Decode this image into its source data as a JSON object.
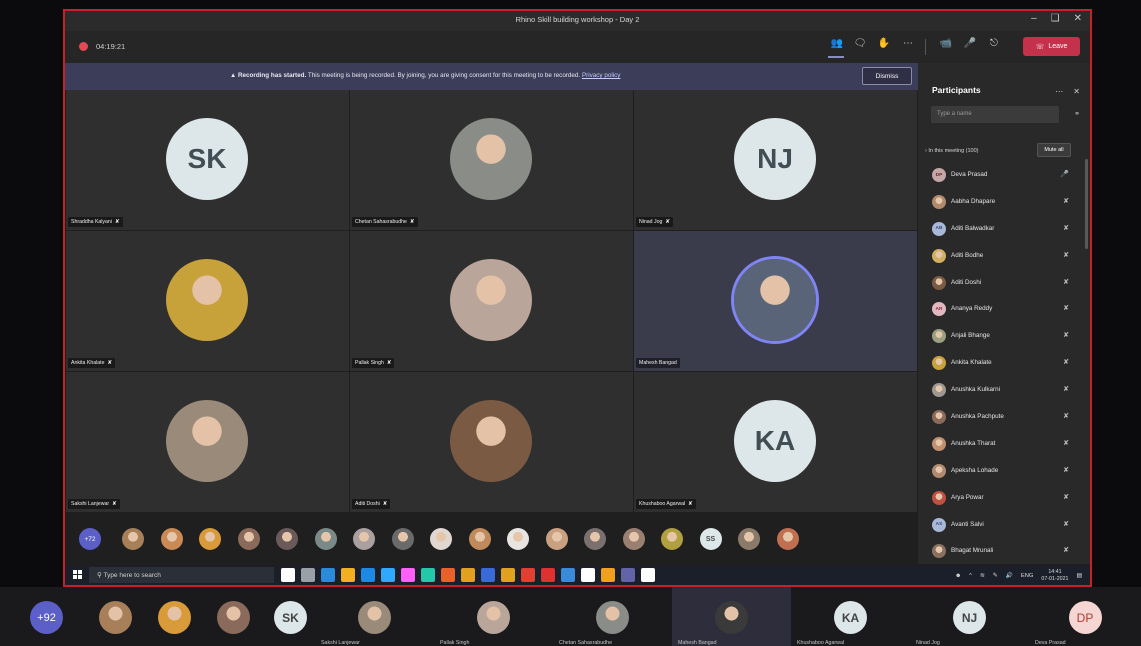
{
  "window": {
    "title": "Rhino Skill building workshop - Day 2"
  },
  "controls": {
    "timer": "04:19:21",
    "leave_label": "Leave"
  },
  "banner": {
    "bold": "Recording has started.",
    "text": "This meeting is being recorded. By joining, you are giving consent for this meeting to be recorded.",
    "link": "Privacy policy",
    "dismiss": "Dismiss"
  },
  "tiles": [
    {
      "name": "Shraddha Kalyani",
      "initials": "SK",
      "kind": "initials"
    },
    {
      "name": "Chetan Sahasrabudhe",
      "kind": "photo",
      "color": "#8a8c88"
    },
    {
      "name": "Ninad Jog",
      "initials": "NJ",
      "kind": "initials"
    },
    {
      "name": "Ankita Khalate",
      "kind": "photo",
      "color": "#c7a13a"
    },
    {
      "name": "Pallak Singh",
      "kind": "photo",
      "color": "#b9a59a"
    },
    {
      "name": "Mahesh Bangad",
      "kind": "photo",
      "color": "#5a6478",
      "speaking": true
    },
    {
      "name": "Sakshi Lanjewar",
      "kind": "photo",
      "color": "#9a8a7a"
    },
    {
      "name": "Aditi Doshi",
      "kind": "photo",
      "color": "#7a5a42"
    },
    {
      "name": "Khushaboo Agarwal",
      "initials": "KA",
      "kind": "initials"
    }
  ],
  "tray": {
    "count": "+72",
    "initials": "SS",
    "colors": [
      "#a7805a",
      "#c98a55",
      "#d99a3a",
      "#8a6a5a",
      "#6a5a5a",
      "#7a8a8a",
      "#aaa0a0",
      "#6a6a6a",
      "#e0d8d0",
      "#c08a5a",
      "#e8e4e0",
      "#c9a080",
      "#7a7070",
      "#9a8070",
      "#b0a040",
      "#8a7a6a",
      "#c07050"
    ]
  },
  "panel": {
    "title": "Participants",
    "search_placeholder": "Type a name",
    "section": "In this meeting (100)",
    "mute_all": "Mute all",
    "participants": [
      {
        "name": "Deva Prasad",
        "initials": "DP",
        "mic_on": true
      },
      {
        "name": "Aabha Dhapare",
        "color": "#b08a6a"
      },
      {
        "name": "Aditi Balwadkar",
        "initials": "AB",
        "bg": "#a9b8d8",
        "fg": "#3b4a7a"
      },
      {
        "name": "Aditi Bodhe",
        "color": "#d0b060"
      },
      {
        "name": "Aditi Doshi",
        "color": "#7a5a42"
      },
      {
        "name": "Ananya Reddy",
        "initials": "AR",
        "bg": "#e2b8c0",
        "fg": "#8a2b40"
      },
      {
        "name": "Anjali Bhange",
        "color": "#9aa080"
      },
      {
        "name": "Ankita Khalate",
        "color": "#c7a13a"
      },
      {
        "name": "Anushka Kulkarni",
        "color": "#a09890"
      },
      {
        "name": "Anushka Pachpute",
        "color": "#8a6a5a"
      },
      {
        "name": "Anushka Tharat",
        "color": "#c09070"
      },
      {
        "name": "Apeksha Lohade",
        "color": "#b08a70"
      },
      {
        "name": "Arya Powar",
        "color": "#c05040"
      },
      {
        "name": "Avanti Salvi",
        "initials": "AS",
        "bg": "#a9b8d8",
        "fg": "#3b4a7a"
      },
      {
        "name": "Bhagat Mrunali",
        "color": "#8a7060"
      }
    ]
  },
  "taskbar": {
    "search": "Type here to search",
    "lang": "ENG",
    "time": "14:41",
    "date": "07-01-2021",
    "app_colors": [
      "#ffffff",
      "#9aa0a8",
      "#2a8bd8",
      "#f0b020",
      "#1e88e5",
      "#31a8ff",
      "#ff61f6",
      "#22c8a8",
      "#e8612a",
      "#e0a020",
      "#3a6ad8",
      "#e0a020",
      "#e04030",
      "#e03030",
      "#3a8ad8",
      "#ffffff",
      "#f0a020",
      "#6264a7",
      "#ffffff"
    ]
  },
  "outer": {
    "count": "+92",
    "cells": [
      {
        "name": "",
        "kind": "photo",
        "color": "#a7805a"
      },
      {
        "name": "",
        "kind": "photo",
        "color": "#d99a3a"
      },
      {
        "name": "",
        "kind": "photo",
        "color": "#8a6a5a"
      },
      {
        "name": "",
        "kind": "initials",
        "initials": "SK"
      },
      {
        "name": "Sakshi Lanjewar",
        "kind": "photo",
        "color": "#9a8a7a"
      },
      {
        "name": "Pallak Singh",
        "kind": "photo",
        "color": "#b9a59a"
      },
      {
        "name": "Chetan Sahasrabudhe",
        "kind": "photo",
        "color": "#8a8c88"
      },
      {
        "name": "Mahesh Bangad",
        "kind": "photo",
        "color": "#3a3a3a",
        "selected": true
      },
      {
        "name": "Khushaboo Agarwal",
        "kind": "initials",
        "initials": "KA"
      },
      {
        "name": "Ninad Jog",
        "kind": "initials",
        "initials": "NJ"
      },
      {
        "name": "Deva Prasad",
        "kind": "dp",
        "initials": "DP"
      }
    ]
  }
}
